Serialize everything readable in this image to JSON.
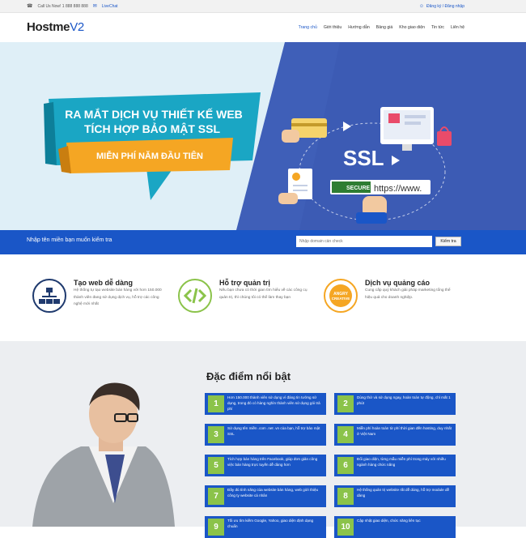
{
  "topbar": {
    "call_text": "Call Us Now! 1 888 888 888",
    "livechat": "LiveChat",
    "auth": "Đăng ký / Đăng nhập"
  },
  "header": {
    "logo_main": "Hostme",
    "logo_suffix": "V2",
    "nav": [
      "Trang chủ",
      "Giới thiệu",
      "Hướng dẫn",
      "Bảng giá",
      "Kho giao diện",
      "Tin tức",
      "Liên hệ"
    ],
    "active_index": 0
  },
  "hero": {
    "headline_1": "RA MẮT DỊCH VỤ THIẾT KẾ WEB",
    "headline_2": "TÍCH HỢP BẢO MẬT SSL",
    "ribbon": "MIỄN PHÍ NĂM ĐẦU TIÊN",
    "ssl": "SSL",
    "secure": "SECURE",
    "url": "https://www."
  },
  "domain_search": {
    "label": "Nhập tên miền bạn muốn kiểm tra",
    "placeholder": "Nhập domain cần check",
    "button": "Kiểm tra"
  },
  "features": [
    {
      "title": "Tạo web dễ dàng",
      "desc": "Hệ thống tự tạo website bán hàng với hơn 150.000 thành viên đang sử dụng dịch vụ, hỗ trợ các công nghệ mới nhất",
      "icon": "sitemap-icon",
      "color": "#1f3a6e"
    },
    {
      "title": "Hỗ trợ quản trị",
      "desc": "Nếu bạn chưa có thời gian tìm hiểu về các công cụ quản trị, thì chúng tôi có thể làm thay bạn",
      "icon": "code-icon",
      "color": "#8bc34a"
    },
    {
      "title": "Dịch vụ quảng cáo",
      "desc": "Cung cấp quý khách giải pháp marketing tổng thể hiệu quả cho doanh nghiệp.",
      "icon": "angry-creative-icon",
      "color": "#f5a623"
    }
  ],
  "highlights": {
    "heading": "Đặc điểm nổi bật",
    "items": [
      {
        "num": "1",
        "text": "Hơn 150.000 thành viên sử dụng vì đáng tin tưởng sử dụng, trong đó có hàng nghìn thành viên sử dụng gói trả phí"
      },
      {
        "num": "2",
        "text": "Dùng thử và sử dụng ngay, hoàn toàn tự động, chỉ mất 1 phút"
      },
      {
        "num": "3",
        "text": "Sử dụng tên miền .com .net .vn của bạn, hỗ trợ bảo mật SSL"
      },
      {
        "num": "4",
        "text": "Miễn phí hoàn toàn từ phí thời gian đến hosting, duy nhất ở Việt Nam"
      },
      {
        "num": "5",
        "text": "Tích hợp bán hàng trên Facebook, giúp đơn giản công việc bán hàng trực tuyến dễ dàng hơn"
      },
      {
        "num": "6",
        "text": "Đổi giao diện, từng mẫu miễn phí trong máy với nhiều ngành hàng chức năng"
      },
      {
        "num": "7",
        "text": "Đầy đủ tính năng của website bán hàng, web giới thiệu công ty website cá nhân"
      },
      {
        "num": "8",
        "text": "Hệ thống quản trị website rất dễ dùng, hỗ trợ module dễ dàng"
      },
      {
        "num": "9",
        "text": "Tối ưu tìm kiếm Google, Yahoo, giao diện định dạng chuẩn"
      },
      {
        "num": "10",
        "text": "Cập nhật giao diện, chức năng liên tục"
      }
    ]
  },
  "colors": {
    "primary": "#1a56c7",
    "accent_green": "#8bc34a",
    "ribbon_teal": "#1aa6c4",
    "ribbon_orange": "#f5a623"
  }
}
